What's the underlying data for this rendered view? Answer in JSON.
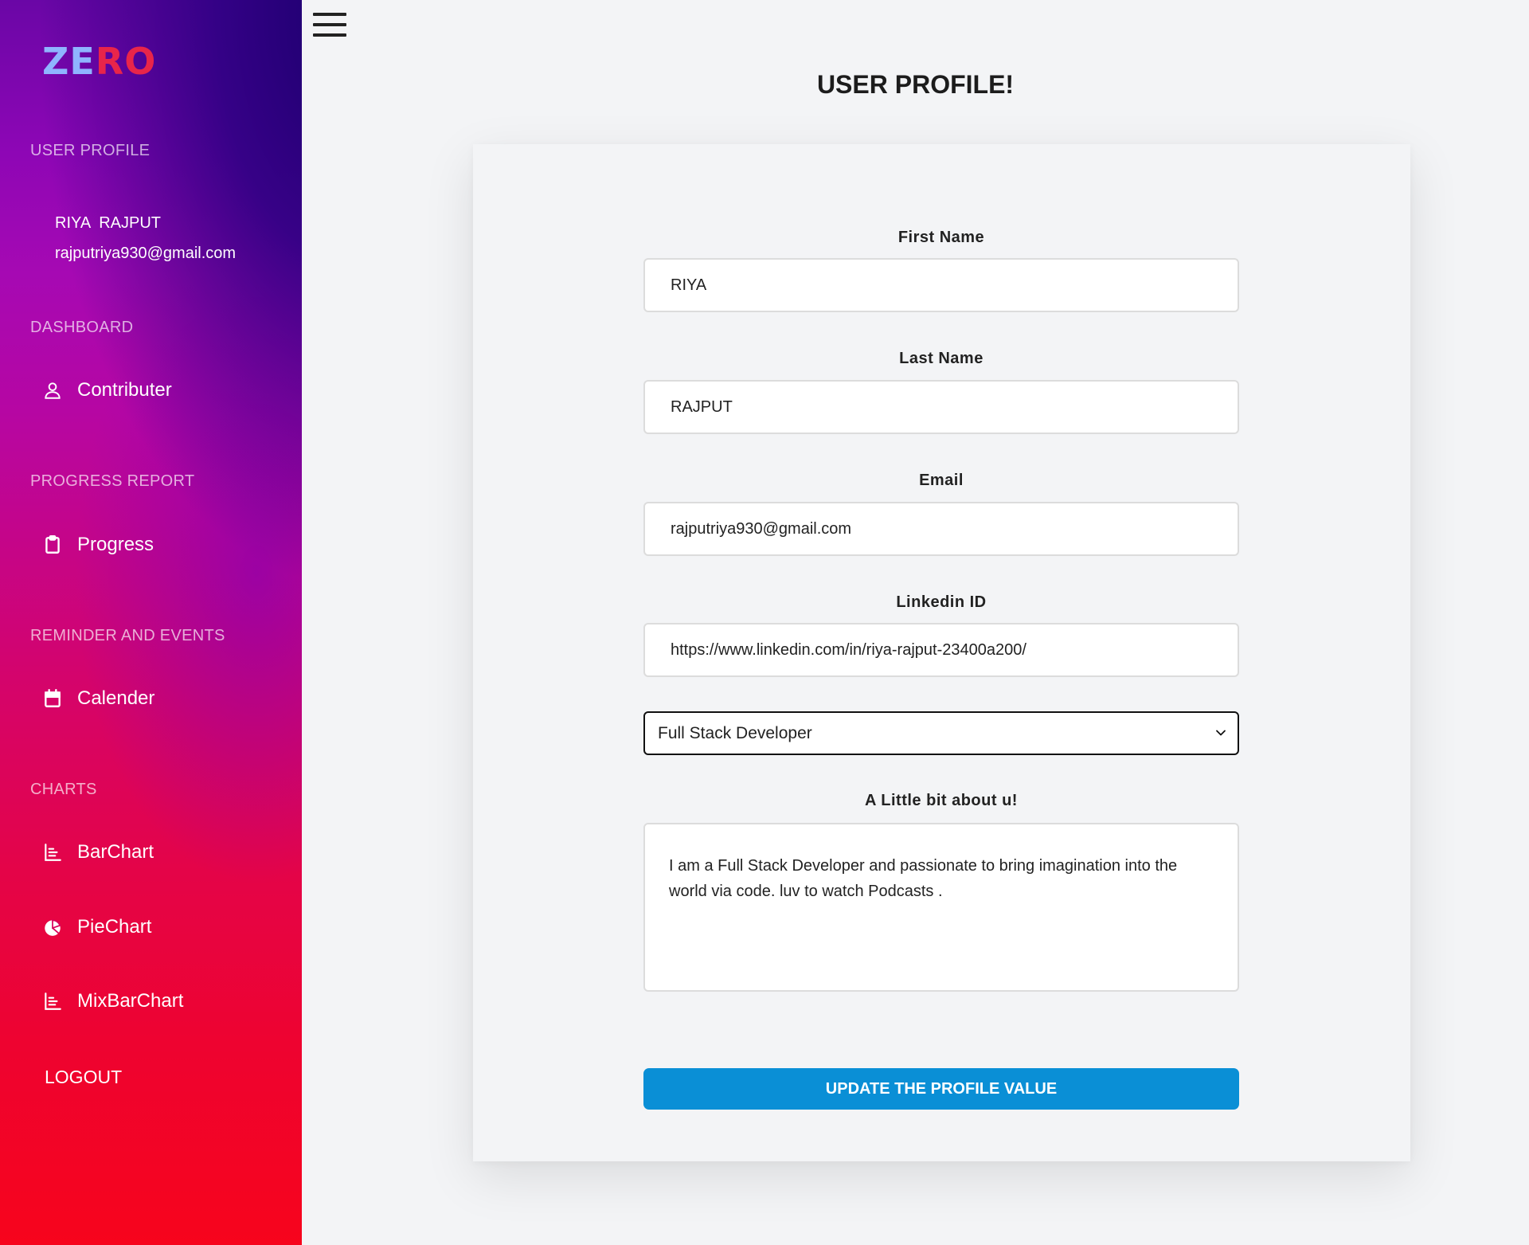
{
  "sidebar": {
    "logo": {
      "part1": "ZE",
      "part2": "RO"
    },
    "sections": {
      "user_profile": "USER PROFILE",
      "dashboard": "DASHBOARD",
      "progress_report": "PROGRESS REPORT",
      "reminder": "REMINDER AND EVENTS",
      "charts": "CHARTS"
    },
    "user": {
      "name": "RIYA  RAJPUT",
      "email": "rajputriya930@gmail.com"
    },
    "items": [
      {
        "label": "Contributer",
        "icon": "user-icon"
      },
      {
        "label": "Progress",
        "icon": "clipboard-icon"
      },
      {
        "label": "Calender",
        "icon": "calendar-icon"
      },
      {
        "label": "BarChart",
        "icon": "bar-chart-icon"
      },
      {
        "label": "PieChart",
        "icon": "pie-chart-icon"
      },
      {
        "label": "MixBarChart",
        "icon": "bar-chart-icon"
      }
    ],
    "logout": "LOGOUT"
  },
  "main": {
    "title": "USER PROFILE!",
    "form": {
      "first_name_label": "First Name",
      "first_name_value": "RIYA",
      "last_name_label": "Last Name",
      "last_name_value": "RAJPUT",
      "email_label": "Email",
      "email_value": "rajputriya930@gmail.com",
      "linkedin_label": "Linkedin ID",
      "linkedin_value": "https://www.linkedin.com/in/riya-rajput-23400a200/",
      "role_selected": "Full Stack Developer",
      "about_label": "A Little bit about u!",
      "about_value": "I am a Full Stack Developer and passionate to bring imagination into the world via code. luv to watch Podcasts .",
      "submit_label": "UPDATE THE PROFILE VALUE"
    }
  },
  "colors": {
    "accent_button": "#0a8fd6",
    "logo_ze": "#8fb4ff",
    "logo_ro": "#e8254a"
  }
}
